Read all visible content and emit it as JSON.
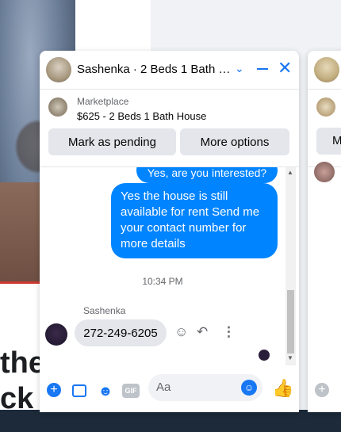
{
  "background": {
    "headline_fragments": [
      "the",
      "ck"
    ]
  },
  "chat": {
    "title": "Sashenka · 2 Beds 1 Bath H…",
    "marketplace_label": "Marketplace",
    "listing_title": "$625 - 2 Beds 1 Bath House",
    "buttons": {
      "pending": "Mark as pending",
      "more": "More options"
    },
    "messages": {
      "outgoing_partial": "Yes, are you interested?",
      "outgoing": "Yes the house is still available for rent Send me your contact number for more details",
      "timestamp": "10:34 PM",
      "sender_name": "Sashenka",
      "incoming": "272-249-6205"
    },
    "composer": {
      "placeholder": "Aa"
    }
  },
  "chat2": {
    "button_partial": "M"
  },
  "colors": {
    "accent": "#1877f2",
    "outgoing_bubble": "#0084ff",
    "incoming_bubble": "#e4e6eb"
  }
}
